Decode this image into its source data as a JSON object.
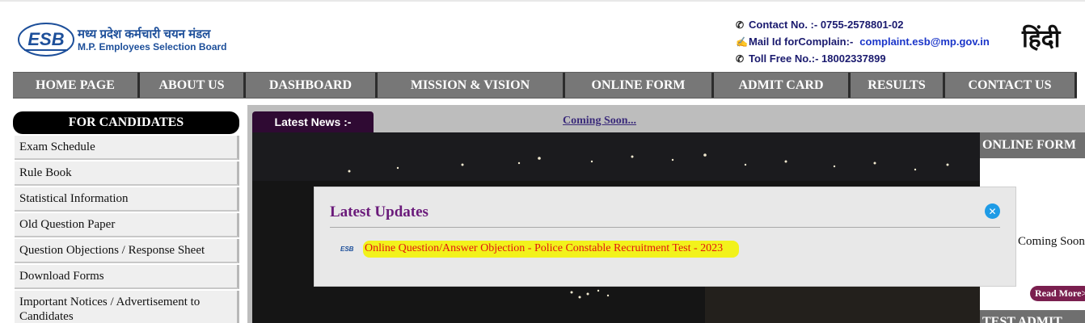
{
  "header": {
    "logo_text_hindi": "मध्य प्रदेश कर्मचारी चयन मंडल",
    "logo_text_english": "M.P. Employees Selection Board",
    "logo_mark": "ESB",
    "contact_label": "Contact No. :- 0755-2578801-02",
    "mail_label": "Mail Id forComplain:-",
    "mail_value": "complaint.esb@mp.gov.in",
    "tollfree_label": "Toll Free No.:- 18002337899",
    "language_link": "हिंदी",
    "icons": [
      "phone-icon",
      "mail-hand-icon",
      "phone-icon"
    ]
  },
  "nav": {
    "items": [
      {
        "label": "HOME PAGE"
      },
      {
        "label": "ABOUT US"
      },
      {
        "label": "DASHBOARD"
      },
      {
        "label": "MISSION & VISION"
      },
      {
        "label": "ONLINE FORM"
      },
      {
        "label": "ADMIT CARD"
      },
      {
        "label": "RESULTS"
      },
      {
        "label": "CONTACT US"
      }
    ]
  },
  "sidebar": {
    "heading": "FOR CANDIDATES",
    "items": [
      {
        "label": "Exam Schedule"
      },
      {
        "label": "Rule Book"
      },
      {
        "label": "Statistical Information"
      },
      {
        "label": "Old Question Paper"
      },
      {
        "label": "Question Objections / Response Sheet"
      },
      {
        "label": "Download Forms"
      },
      {
        "label": "Important Notices / Advertisement to Candidates"
      }
    ]
  },
  "news": {
    "label": "Latest News :-",
    "ticker": "Coming Soon..."
  },
  "right_panel": {
    "heading": "ONLINE FORM",
    "text": "Coming Soon",
    "read_more": "Read More>",
    "heading2": "TEST ADMIT"
  },
  "modal": {
    "title": "Latest Updates",
    "close_icon": "close-icon",
    "items": [
      {
        "label": "Online Question/Answer Objection - Police Constable Recruitment Test - 2023",
        "icon": "esb-logo-icon"
      }
    ]
  },
  "colors": {
    "nav_bg": "#777777",
    "nav_divider": "#2c2c2c",
    "modal_title": "#6a1a7a",
    "highlight": "#f2f21c",
    "link_red": "#e0170f",
    "close_blue": "#1e9be6",
    "news_label_bg": "#2f0a33"
  }
}
